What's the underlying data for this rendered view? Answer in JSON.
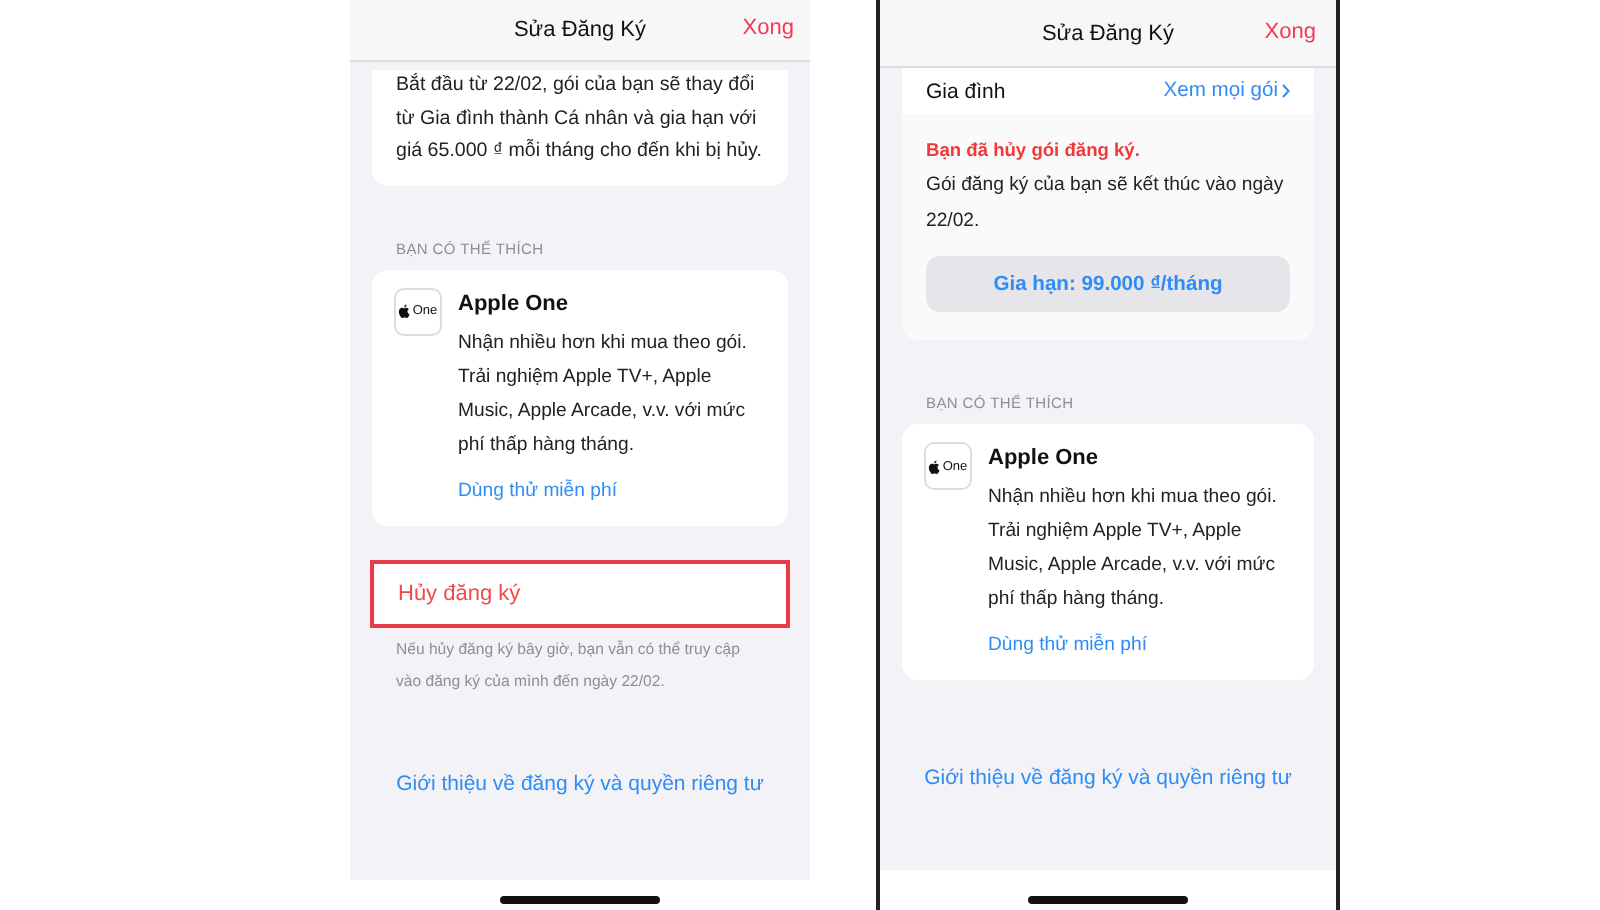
{
  "screens": [
    {
      "header": {
        "title": "Sửa Đăng Ký",
        "done": "Xong"
      },
      "sections": [
        {
          "kind": "note_card",
          "text": "Bắt đầu từ 22/02, gói của bạn sẽ thay đổi từ Gia đình thành Cá nhân và gia hạn với giá 65.000 ₫ mỗi tháng cho đến khi bị hủy."
        },
        {
          "kind": "section_label",
          "text": "BẠN CÓ THỂ THÍCH"
        },
        {
          "kind": "promo_card",
          "logo": "One",
          "title": "Apple One",
          "text": "Nhận nhiều hơn khi mua theo gói. Trải nghiệm Apple TV+, Apple Music, Apple Arcade, v.v. với mức phí thấp hàng tháng.",
          "link": "Dùng thử miễn phí"
        },
        {
          "kind": "cancel_row",
          "text": "Hủy đăng ký",
          "highlighted": true
        },
        {
          "kind": "footnote",
          "text": "Nếu hủy đăng ký bây giờ, bạn vẫn có thể truy cập vào đăng ký của mình đến ngày 22/02."
        },
        {
          "kind": "link",
          "text": "Giới thiệu về đăng ký và quyền riêng tư"
        }
      ]
    },
    {
      "header": {
        "title": "Sửa Đăng Ký",
        "done": "Xong"
      },
      "sections": [
        {
          "kind": "cancelled_card",
          "plan": "Gia đình",
          "plans_link": "Xem mọi gói",
          "alert": "Bạn đã hủy gói đăng ký.",
          "text": "Gói đăng ký của bạn sẽ kết thúc vào ngày 22/02.",
          "button": "Gia hạn: 99.000 ₫/tháng"
        },
        {
          "kind": "section_label",
          "text": "BẠN CÓ THỂ THÍCH"
        },
        {
          "kind": "promo_card",
          "logo": "One",
          "title": "Apple One",
          "text": "Nhận nhiều hơn khi mua theo gói. Trải nghiệm Apple TV+, Apple Music, Apple Arcade, v.v. với mức phí thấp hàng tháng.",
          "link": "Dùng thử miễn phí"
        },
        {
          "kind": "link",
          "text": "Giới thiệu về đăng ký và quyền riêng tư"
        }
      ]
    }
  ]
}
